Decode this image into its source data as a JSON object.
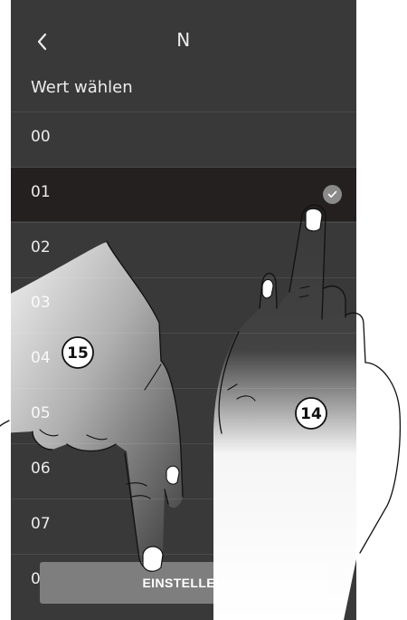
{
  "header": {
    "title": "N",
    "back_icon": "chevron-left-icon"
  },
  "list": {
    "heading": "Wert wählen",
    "items": [
      {
        "label": "00",
        "selected": false
      },
      {
        "label": "01",
        "selected": true
      },
      {
        "label": "02",
        "selected": false
      },
      {
        "label": "03",
        "selected": false
      },
      {
        "label": "04",
        "selected": false
      },
      {
        "label": "05",
        "selected": false
      },
      {
        "label": "06",
        "selected": false
      },
      {
        "label": "07",
        "selected": false
      },
      {
        "label": "0",
        "selected": false
      }
    ]
  },
  "footer": {
    "set_label": "EINSTELLEN"
  },
  "callouts": {
    "right_hand": "14",
    "left_hand": "15"
  },
  "colors": {
    "screen_bg": "#393939",
    "selected_row_bg": "#242020",
    "button_bg": "#7e7e7e",
    "check_bg": "#8a8a8a",
    "text": "#ececec"
  }
}
